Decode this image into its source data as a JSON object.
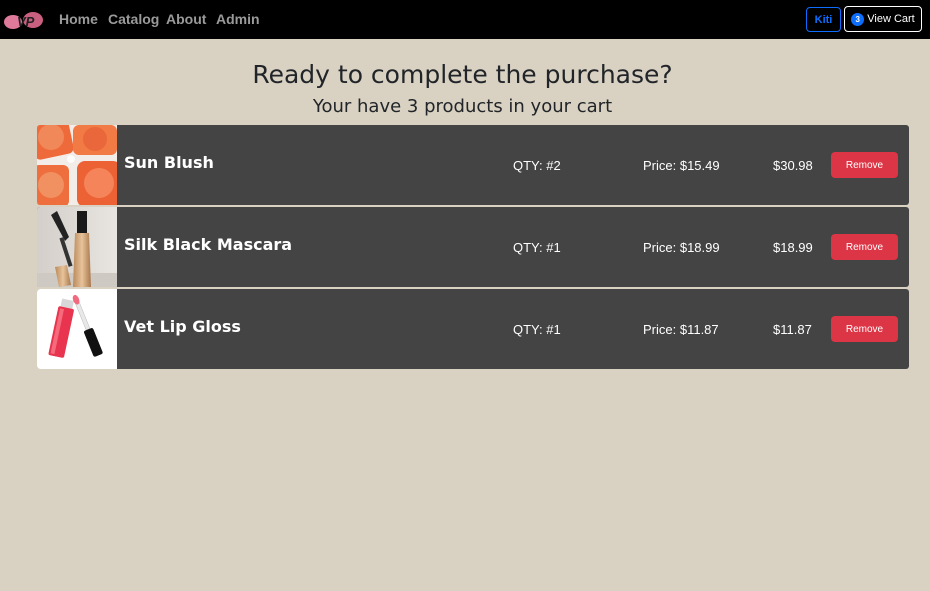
{
  "nav": {
    "logo_text": "VP",
    "links": [
      "Home",
      "Catalog",
      "About",
      "Admin"
    ],
    "user_label": "Kiti",
    "cart_count": "3",
    "cart_label": "View Cart"
  },
  "page": {
    "heading": "Ready to complete the purchase?",
    "subheading": "Your have 3 products in your cart"
  },
  "cart_items": [
    {
      "name": "Sun Blush",
      "qty": "QTY: #2",
      "price": "Price: $15.49",
      "total": "$30.98",
      "remove_label": "Remove",
      "image": "blush-icon"
    },
    {
      "name": "Silk Black Mascara",
      "qty": "QTY: #1",
      "price": "Price: $18.99",
      "total": "$18.99",
      "remove_label": "Remove",
      "image": "mascara-icon"
    },
    {
      "name": "Vet Lip Gloss",
      "qty": "QTY: #1",
      "price": "Price: $11.87",
      "total": "$11.87",
      "remove_label": "Remove",
      "image": "lip-gloss-icon"
    }
  ],
  "colors": {
    "background": "#d9d1c1",
    "navbar": "#000000",
    "row": "#444444",
    "remove": "#dc3545",
    "primary": "#0d6efd"
  }
}
